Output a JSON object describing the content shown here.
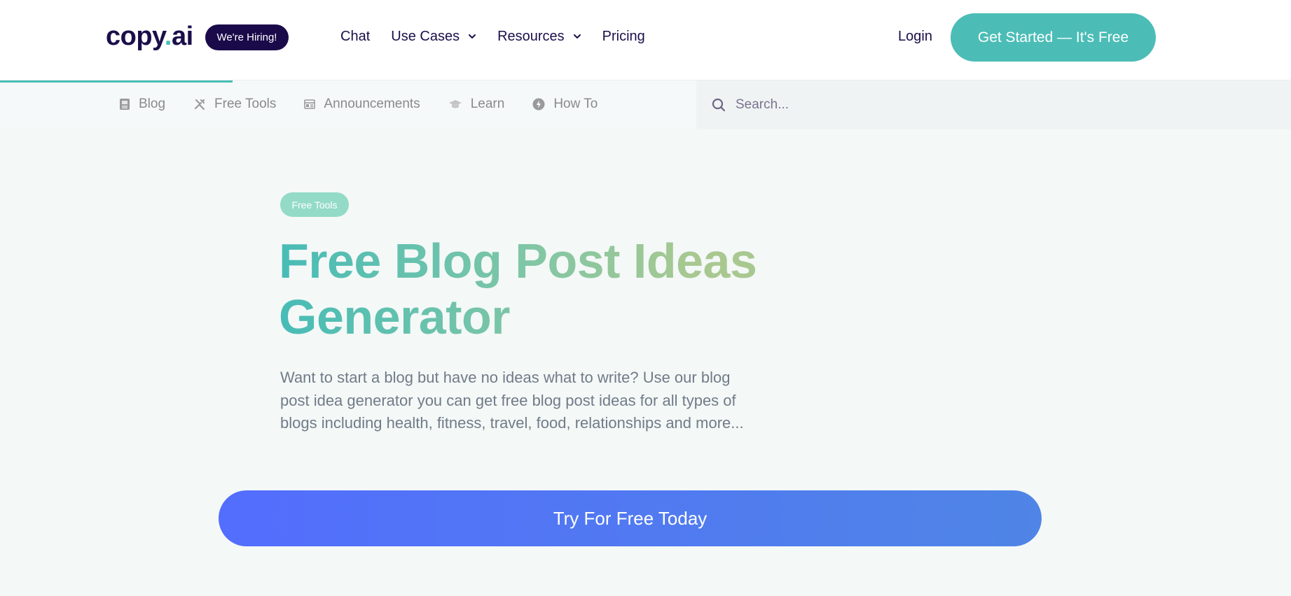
{
  "header": {
    "logo_main": "copy",
    "logo_dot": ".",
    "logo_suffix": "ai",
    "hiring_badge": "We're Hiring!",
    "nav": [
      {
        "label": "Chat",
        "has_dropdown": false
      },
      {
        "label": "Use Cases",
        "has_dropdown": true
      },
      {
        "label": "Resources",
        "has_dropdown": true
      },
      {
        "label": "Pricing",
        "has_dropdown": false
      }
    ],
    "login_label": "Login",
    "cta_label": "Get Started — It's Free"
  },
  "subnav": {
    "reading_progress": 0.18,
    "items": [
      {
        "label": "Blog",
        "icon": "document-icon"
      },
      {
        "label": "Free Tools",
        "icon": "tools-icon"
      },
      {
        "label": "Announcements",
        "icon": "newspaper-icon"
      },
      {
        "label": "Learn",
        "icon": "graduation-cap-icon"
      },
      {
        "label": "How To",
        "icon": "lightning-icon"
      }
    ],
    "search_placeholder": "Search..."
  },
  "hero": {
    "badge": "Free Tools",
    "title": "Free Blog Post Ideas Generator",
    "description": "Want to start a blog but have no ideas what to write? Use our blog post idea generator you can get free blog post ideas for all types of blogs including health, fitness, travel, food, relationships and more...",
    "cta_label": "Try For Free Today"
  },
  "colors": {
    "brand_teal": "#4bbdb6",
    "brand_navy": "#1b0a4a",
    "cta_blue_start": "#536dfd",
    "cta_blue_end": "#4f85e6",
    "badge_mint": "#93dbc6"
  }
}
